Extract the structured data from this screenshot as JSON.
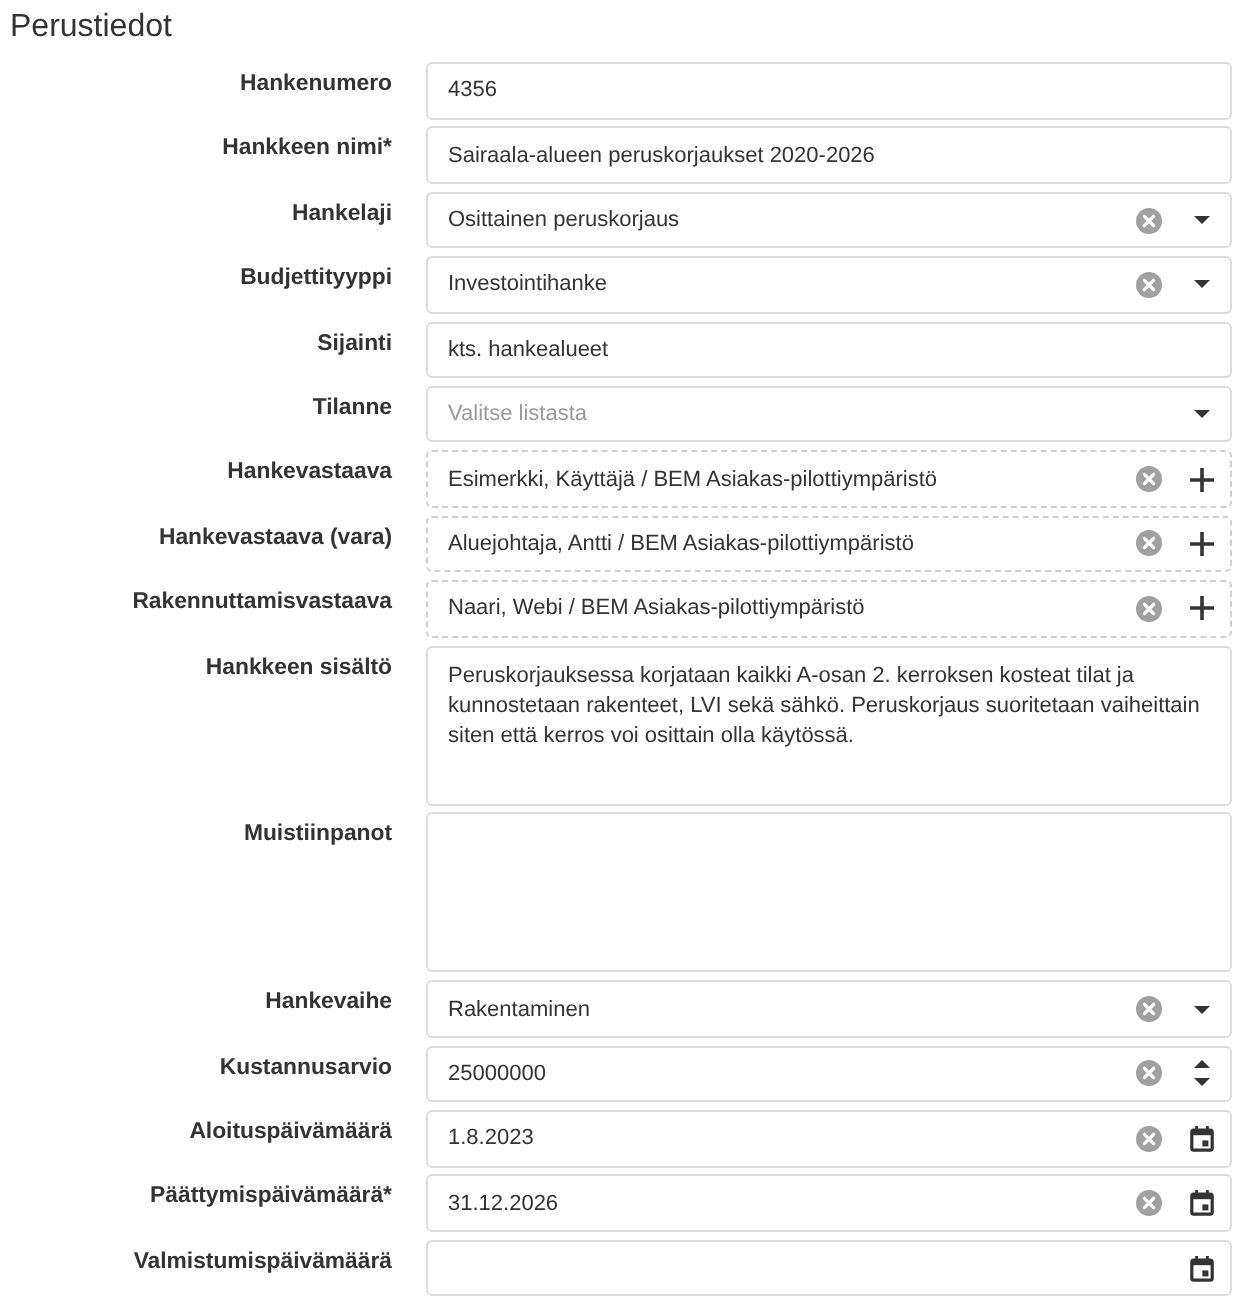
{
  "section_title": "Perustiedot",
  "fields": [
    {
      "kind": "text",
      "label": "Hankenumero",
      "value": "4356"
    },
    {
      "kind": "text",
      "label": "Hankkeen nimi*",
      "value": "Sairaala-alueen peruskorjaukset 2020-2026"
    },
    {
      "kind": "select",
      "label": "Hankelaji",
      "value": "Osittainen peruskorjaus"
    },
    {
      "kind": "select",
      "label": "Budjettityyppi",
      "value": "Investointihanke"
    },
    {
      "kind": "text",
      "label": "Sijainti",
      "value": "kts. hankealueet"
    },
    {
      "kind": "select",
      "label": "Tilanne",
      "placeholder": "Valitse listasta"
    },
    {
      "kind": "lookup",
      "label": "Hankevastaava",
      "value": "Esimerkki, Käyttäjä / BEM Asiakas-pilottiympäristö"
    },
    {
      "kind": "lookup",
      "label": "Hankevastaava (vara)",
      "value": "Aluejohtaja, Antti / BEM Asiakas-pilottiympäristö"
    },
    {
      "kind": "lookup",
      "label": "Rakennuttamisvastaava",
      "value": "Naari, Webi / BEM Asiakas-pilottiympäristö"
    },
    {
      "kind": "textarea",
      "label": "Hankkeen sisältö",
      "value": "Peruskorjauksessa korjataan kaikki A-osan 2. kerroksen kosteat tilat ja kunnostetaan rakenteet, LVI sekä sähkö. Peruskorjaus suoritetaan vaiheittain siten että kerros voi osittain olla käytössä."
    },
    {
      "kind": "textarea",
      "label": "Muistiinpanot"
    },
    {
      "kind": "select",
      "label": "Hankevaihe",
      "value": "Rakentaminen"
    },
    {
      "kind": "number",
      "label": "Kustannusarvio",
      "value": "25000000"
    },
    {
      "kind": "date",
      "label": "Aloituspäivämäärä",
      "value": "1.8.2023"
    },
    {
      "kind": "date",
      "label": "Päättymispäivämäärä*",
      "value": "31.12.2026"
    },
    {
      "kind": "date",
      "label": "Valmistumispäivämäärä"
    }
  ]
}
